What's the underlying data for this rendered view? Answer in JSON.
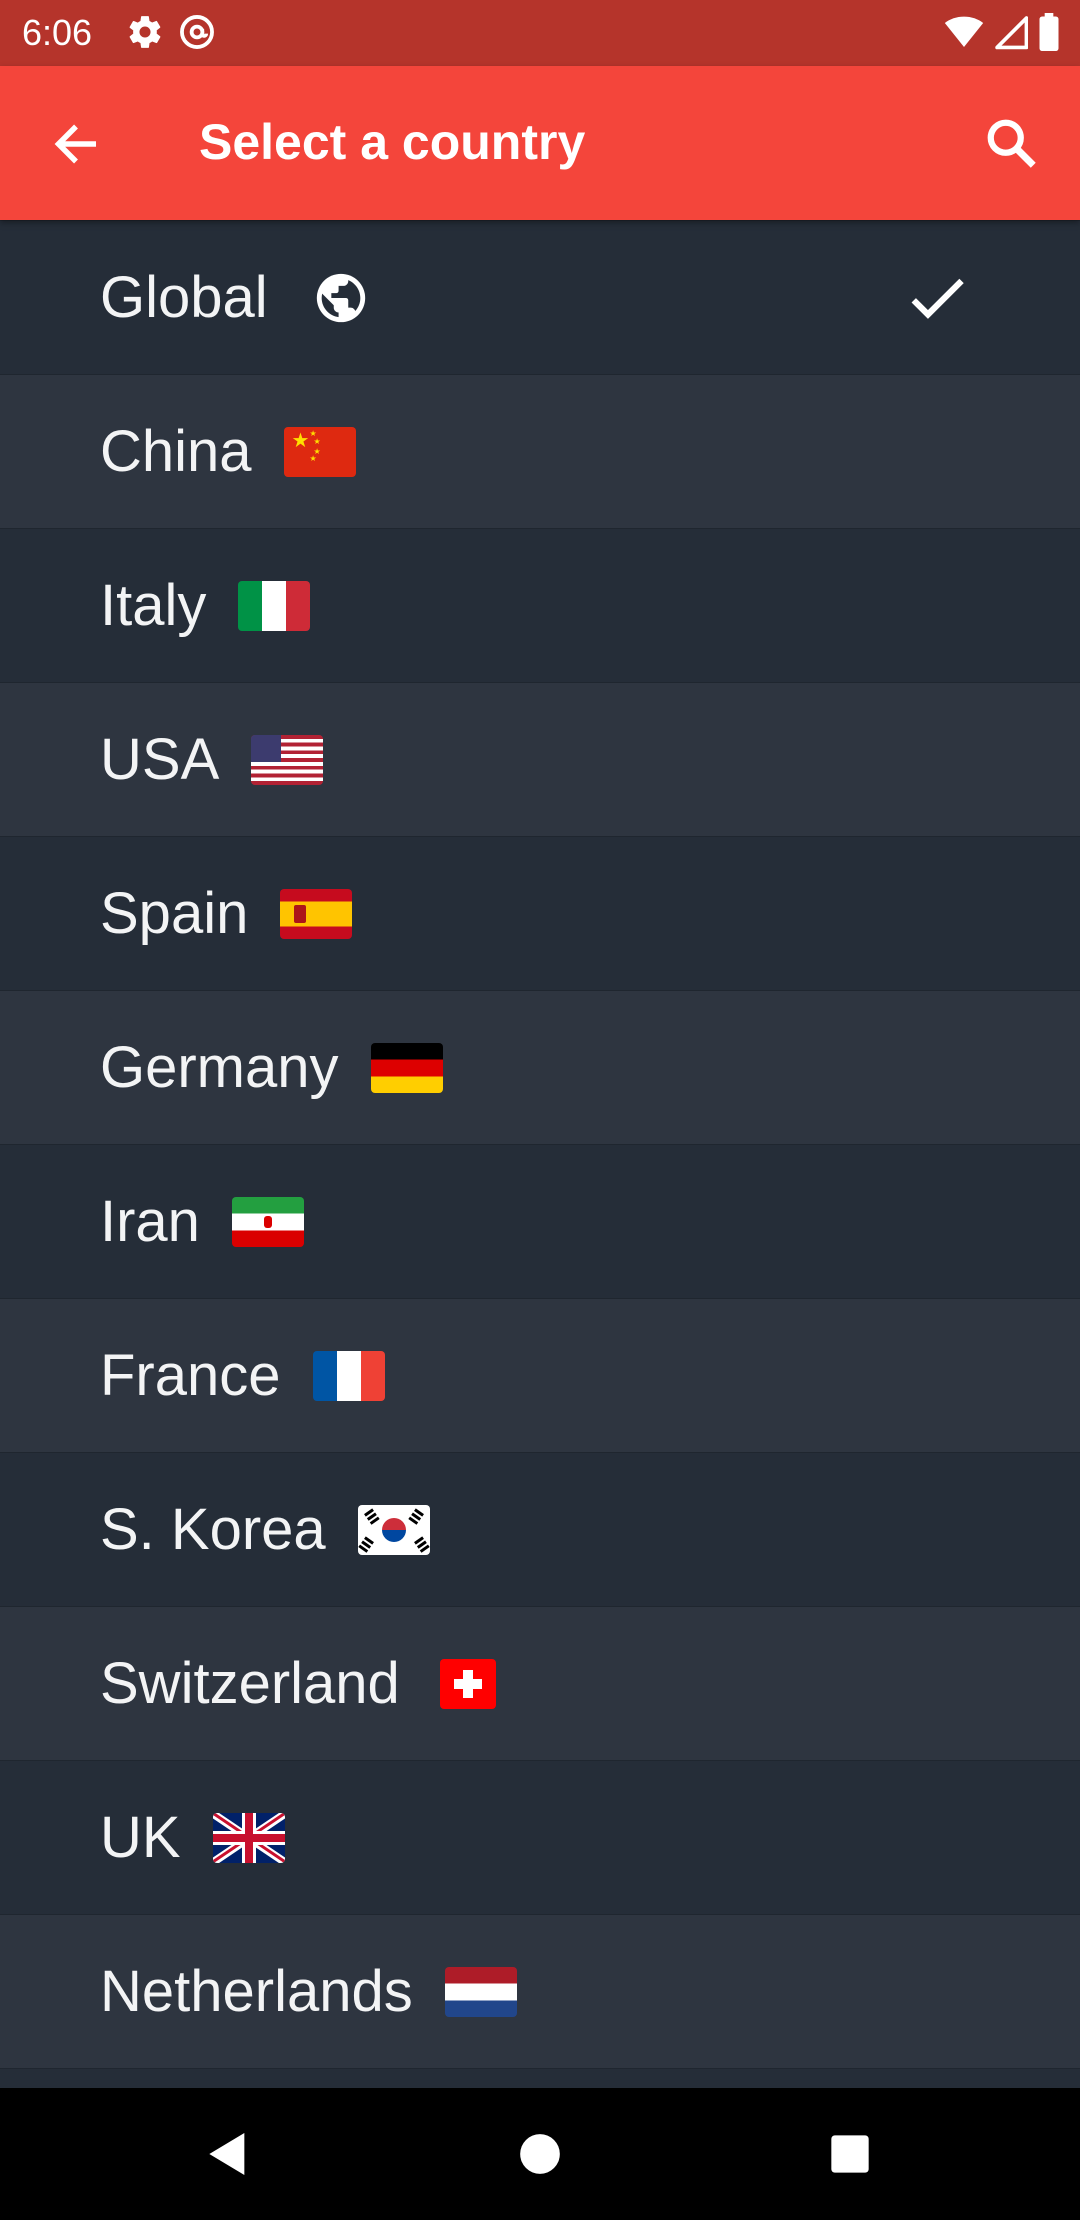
{
  "status_bar": {
    "time": "6:06",
    "left_icons": [
      "gear-icon",
      "at-sign-icon"
    ],
    "right_icons": [
      "wifi-icon",
      "cell-signal-icon",
      "battery-icon"
    ]
  },
  "app_bar": {
    "title": "Select a country",
    "back_icon": "arrow-back-icon",
    "search_icon": "search-icon",
    "color": "#f4453b"
  },
  "countries": [
    {
      "label": "Global",
      "icon": "globe-icon",
      "selected": true
    },
    {
      "label": "China",
      "icon": "flag-china"
    },
    {
      "label": "Italy",
      "icon": "flag-italy"
    },
    {
      "label": "USA",
      "icon": "flag-usa"
    },
    {
      "label": "Spain",
      "icon": "flag-spain"
    },
    {
      "label": "Germany",
      "icon": "flag-germany"
    },
    {
      "label": "Iran",
      "icon": "flag-iran"
    },
    {
      "label": "France",
      "icon": "flag-france"
    },
    {
      "label": "S. Korea",
      "icon": "flag-south-korea"
    },
    {
      "label": "Switzerland",
      "icon": "flag-switzerland"
    },
    {
      "label": "UK",
      "icon": "flag-uk"
    },
    {
      "label": "Netherlands",
      "icon": "flag-netherlands"
    }
  ],
  "nav_bar": {
    "icons": [
      "back-triangle-icon",
      "home-circle-icon",
      "recents-square-icon"
    ]
  }
}
